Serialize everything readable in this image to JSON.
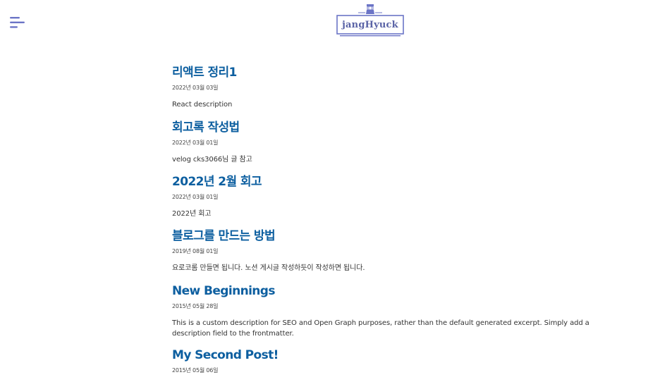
{
  "header": {
    "logo_text": "jangHyuck",
    "menu_icon": "menu-icon",
    "accent_color": "#6b74c6"
  },
  "posts": [
    {
      "title": "리액트 정리1",
      "date": "2022년 03월 03일",
      "description": "React description"
    },
    {
      "title": "회고록 작성법",
      "date": "2022년 03월 01일",
      "description": "velog cks3066님 글 참고"
    },
    {
      "title": "2022년 2월 회고",
      "date": "2022년 03월 01일",
      "description": "2022년 회고"
    },
    {
      "title": "블로그를 만드는 방법",
      "date": "2019년 08월 01일",
      "description": "요로코롬 만들면 됩니다. 노션 게시글 작성하듯이 작성하면 됩니다."
    },
    {
      "title": "New Beginnings",
      "date": "2015년 05월 28일",
      "description": "This is a custom description for SEO and Open Graph purposes, rather than the default generated excerpt. Simply add a description field to the frontmatter."
    },
    {
      "title": "My Second Post!",
      "date": "2015년 05월 06일",
      "description": ""
    }
  ],
  "colors": {
    "title": "#0d5fa0",
    "logo": "#6b74c6"
  }
}
